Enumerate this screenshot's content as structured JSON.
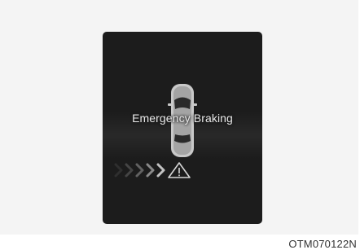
{
  "display": {
    "message": "Emergency Braking"
  },
  "icons": {
    "vehicle": "car-top-view-icon",
    "chevrons": "chevron-right-icon",
    "warning": "warning-triangle-icon"
  },
  "caption": {
    "code": "OTM070122N"
  },
  "colors": {
    "display_bg": "#1c1c1c",
    "text": "#e8e8e8",
    "caption_text": "#333333"
  }
}
